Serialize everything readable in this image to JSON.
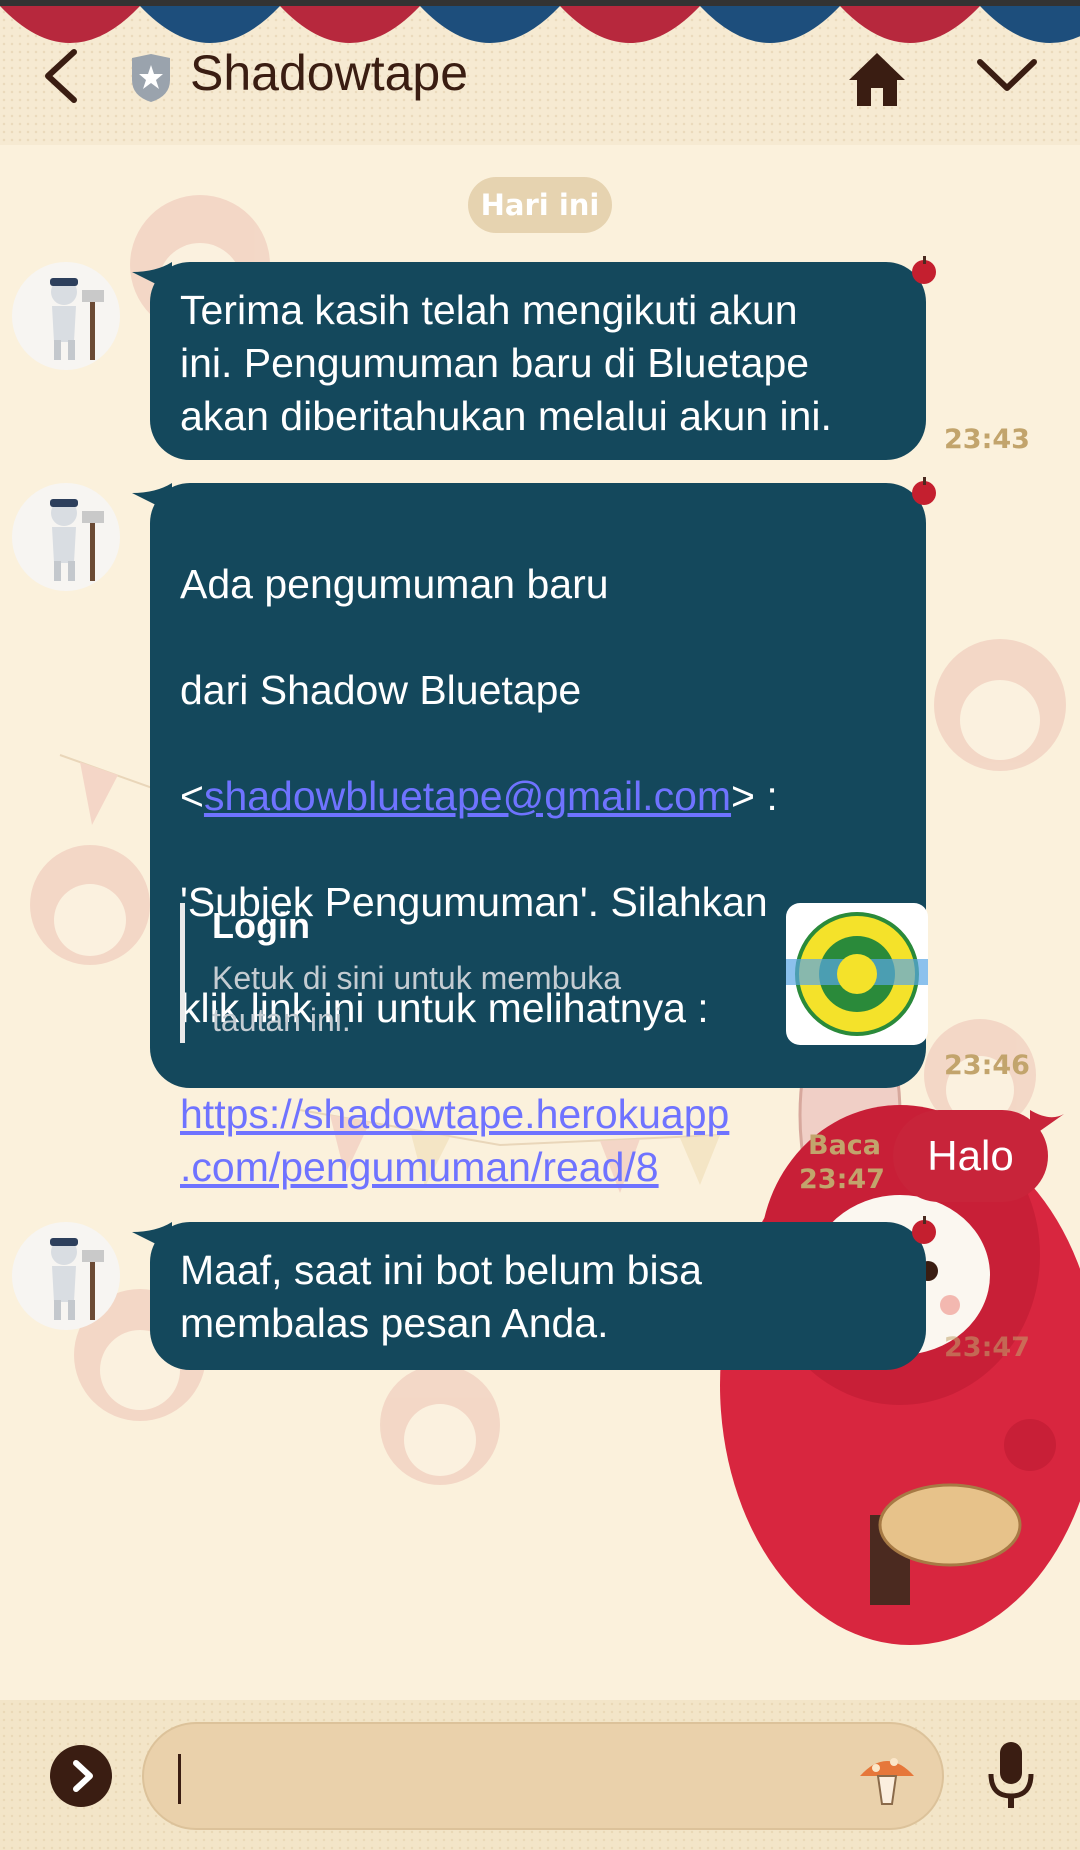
{
  "header": {
    "title": "Shadowtape"
  },
  "chat": {
    "date_label": "Hari ini",
    "messages": [
      {
        "text": "Terima kasih telah mengikuti akun\nini. Pengumuman baru di Bluetape\nakan diberitahukan melalui akun ini.",
        "time": "23:43"
      },
      {
        "text_line1": "Ada pengumuman baru",
        "text_line2": "dari Shadow Bluetape",
        "email_open": "<",
        "email": "shadowbluetape@gmail.com",
        "email_close": "> :",
        "text_line4": "'Subjek Pengumuman'. Silahkan",
        "text_line5": "klik link ini untuk melihatnya :",
        "link_line1": "https://shadowtape.herokuapp",
        "link_line2": ".com/pengumuman/read/8",
        "preview_title": "Login",
        "preview_desc": "Ketuk di sini untuk membuka tautan ini.",
        "time": "23:46"
      },
      {
        "text": "Maaf, saat ini bot belum bisa\nmembalas pesan Anda.",
        "time": "23:47"
      }
    ],
    "sent": {
      "text": "Halo",
      "read_label": "Baca",
      "time": "23:47"
    }
  },
  "input": {
    "value": ""
  },
  "colors": {
    "bubble_bg": "#14485c",
    "sent_bg": "#c8243a",
    "time_color": "#c2a46c",
    "link_color": "#6f73ff"
  },
  "icons": [
    "back-icon",
    "shield-star-icon",
    "home-icon",
    "chevron-down-icon",
    "expand-icon",
    "mushroom-sticker-icon",
    "microphone-icon"
  ]
}
